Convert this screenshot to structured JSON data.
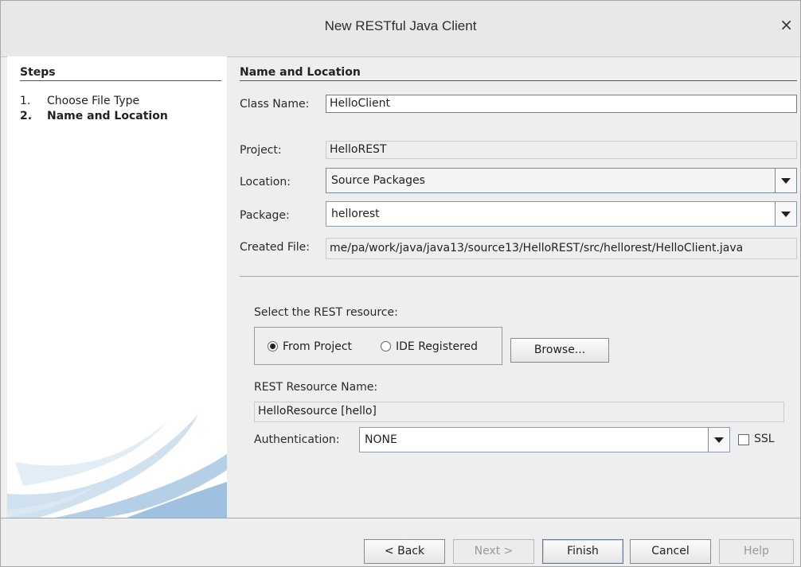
{
  "window": {
    "title": "New RESTful Java Client",
    "close_glyph": "×"
  },
  "steps": {
    "heading": "Steps",
    "items": [
      {
        "number": "1.",
        "label": "Choose File Type"
      },
      {
        "number": "2.",
        "label": "Name and Location"
      }
    ]
  },
  "form": {
    "section_title": "Name and Location",
    "class_name": {
      "label": "Class Name:",
      "mnemonic": "N",
      "value": "HelloClient"
    },
    "project": {
      "label": "Project:",
      "value": "HelloREST"
    },
    "location": {
      "label": "Location:",
      "value": "Source Packages"
    },
    "package": {
      "label": "Package:",
      "value": "hellorest"
    },
    "created_file": {
      "label": "Created File:",
      "value": "me/pa/work/java/java13/source13/HelloREST/src/hellorest/HelloClient.java"
    },
    "rest": {
      "select_label": "Select the REST resource:",
      "from_project": "From Project",
      "ide_registered": "IDE Registered",
      "selected": "From Project",
      "browse": "Browse...",
      "resource_name_label": "REST Resource Name:",
      "resource_name_value": "HelloResource [hello]",
      "authentication_label": "Authentication:",
      "authentication_value": "NONE",
      "ssl_label": "SSL",
      "ssl_checked": false
    }
  },
  "footer": {
    "back": "< Back",
    "next": "Next >",
    "finish": "Finish",
    "cancel": "Cancel",
    "help": "Help"
  },
  "colors": {
    "accent": "#3a7bb8",
    "swoosh_light": "#d7e6f3",
    "swoosh_mid": "#a9c8e4"
  }
}
